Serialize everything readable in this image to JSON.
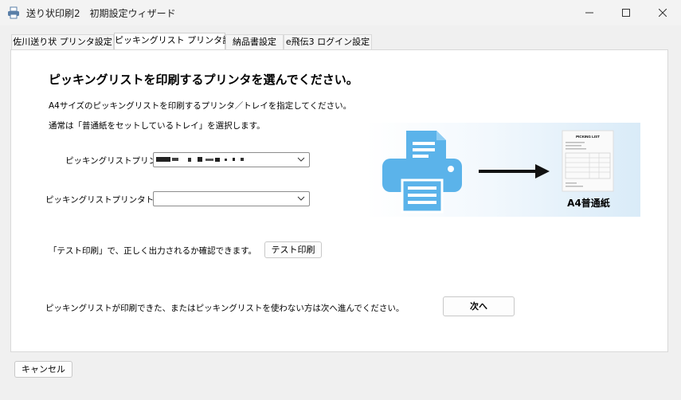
{
  "window": {
    "title": "送り状印刷2　初期設定ウィザード",
    "icon": "printer-icon",
    "controls": [
      "minimize-icon",
      "maximize-icon",
      "close-icon"
    ]
  },
  "tabs": [
    {
      "label": "佐川送り状 プリンタ設定",
      "active": false
    },
    {
      "label": "ピッキングリスト プリンタ設定",
      "active": true
    },
    {
      "label": "納品書設定",
      "active": false
    },
    {
      "label": "e飛伝3 ログイン設定",
      "active": false
    }
  ],
  "main": {
    "heading": "ピッキングリストを印刷するプリンタを選んでください。",
    "description1": "A4サイズのピッキングリストを印刷するプリンタ／トレイを指定してください。",
    "description2": "通常は「普通紙をセットしているトレイ」を選択します。",
    "printer_label": "ピッキングリストプリンタ",
    "tray_label": "ピッキングリストプリンタトレイ",
    "tray_value": "",
    "test_note": "「テスト印刷」で、正しく出力されるか確認できます。",
    "test_button": "テスト印刷",
    "next_note": "ピッキングリストが印刷できた、またはピッキングリストを使わない方は次へ進んでください。",
    "next_button": "次へ"
  },
  "illustration": {
    "sheet_title": "PICKING LIST",
    "paper_label": "A4普通紙",
    "printer_color": "#5bb3ea",
    "icons": [
      "printer-icon",
      "arrow-right-icon",
      "document-icon"
    ]
  },
  "footer": {
    "cancel_button": "キャンセル"
  }
}
